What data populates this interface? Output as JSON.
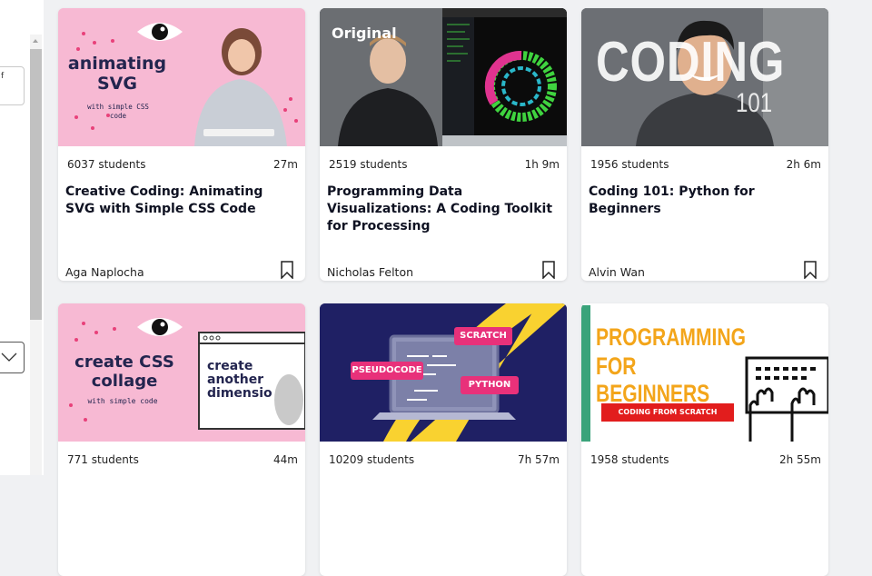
{
  "sidebar": {
    "filter_label": "f",
    "dropdown_icon": "chevron-down-icon"
  },
  "cards": [
    {
      "students": "6037 students",
      "duration": "27m",
      "title": "Creative Coding: Animating SVG with Simple CSS Code",
      "author": "Aga Naplocha",
      "thumb": {
        "heading": "animating SVG",
        "sub": "with simple CSS code",
        "bg": "#f7b9d3"
      }
    },
    {
      "students": "2519 students",
      "duration": "1h 9m",
      "title": "Programming Data Visualizations: A Coding Toolkit for Processing",
      "author": "Nicholas Felton",
      "thumb": {
        "badge": "Original"
      }
    },
    {
      "students": "1956 students",
      "duration": "2h 6m",
      "title": "Coding 101: Python for Beginners",
      "author": "Alvin Wan",
      "thumb": {
        "bg_text": "CODING",
        "bg_sub": "101"
      }
    },
    {
      "students": "771 students",
      "duration": "44m",
      "title": "",
      "author": "",
      "thumb": {
        "heading": "create CSS collage",
        "sub": "with simple code",
        "window_text": "create another dimensio",
        "bg": "#f7b9d3"
      }
    },
    {
      "students": "10209 students",
      "duration": "7h 57m",
      "title": "",
      "author": "",
      "thumb": {
        "tag1": "SCRATCH",
        "tag2": "PSEUDOCODE",
        "tag3": "PYTHON"
      }
    },
    {
      "students": "1958 students",
      "duration": "2h 55m",
      "title": "",
      "author": "",
      "thumb": {
        "line1": "PROGRAMMING",
        "line2": "FOR",
        "line3": "BEGINNERS",
        "ribbon": "CODING FROM SCRATCH"
      }
    }
  ],
  "colors": {
    "accent_pink": "#f7b9d3",
    "navy": "#1f2064",
    "yellow": "#f9d230",
    "tag_pink": "#e8317a",
    "orange": "#f3a51a",
    "red": "#e21d1d"
  }
}
